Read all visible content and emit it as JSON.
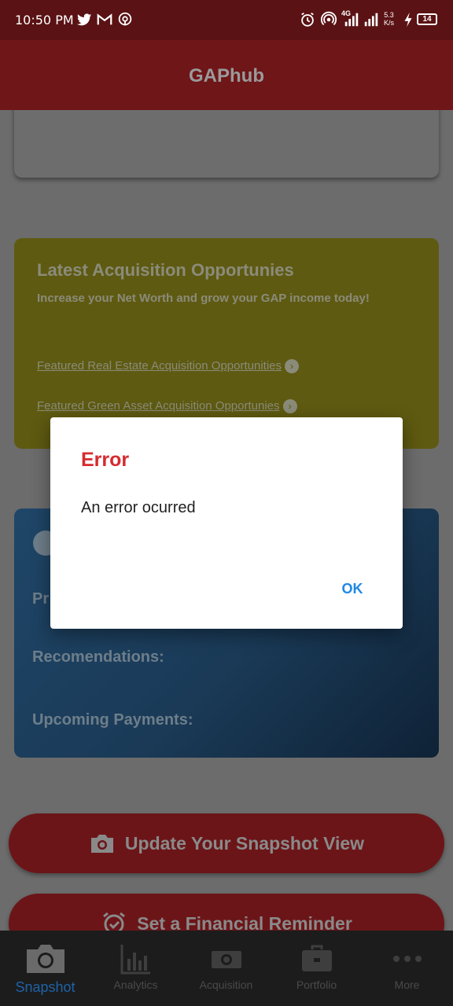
{
  "status_bar": {
    "time": "10:50 PM",
    "speed": "5.3",
    "speed_unit": "K/s",
    "network": "4G",
    "battery": "14",
    "icons": [
      "twitter-icon",
      "gmail-icon",
      "podcast-icon",
      "alarm-icon",
      "hotspot-icon",
      "signal-icon",
      "charging-icon"
    ]
  },
  "app_bar": {
    "title": "GAPhub"
  },
  "acquisition_card": {
    "title": "Latest Acquisition Opportunies",
    "subtitle": "Increase your Net Worth and grow your GAP income today!",
    "links": [
      "Featured Real Estate Acquisition Opportunities",
      "Featured Green Asset Acquisition Opportunies"
    ]
  },
  "profile_card": {
    "line_1": "Pr",
    "line_2": "Recomendations:",
    "line_3": "Upcoming Payments:"
  },
  "buttons": {
    "update_snapshot": "Update Your Snapshot View",
    "set_reminder": "Set a Financial Reminder"
  },
  "bottom_nav": {
    "items": [
      "Snapshot",
      "Analytics",
      "Acquisition",
      "Portfolio",
      "More"
    ],
    "active": "Snapshot"
  },
  "dialog": {
    "title": "Error",
    "message": "An error ocurred",
    "ok_label": "OK"
  },
  "colors": {
    "app_bar": "#6f1619",
    "error_title": "#d62b2f",
    "ok_button": "#1e88e5",
    "active_nav": "#1e63a8"
  }
}
